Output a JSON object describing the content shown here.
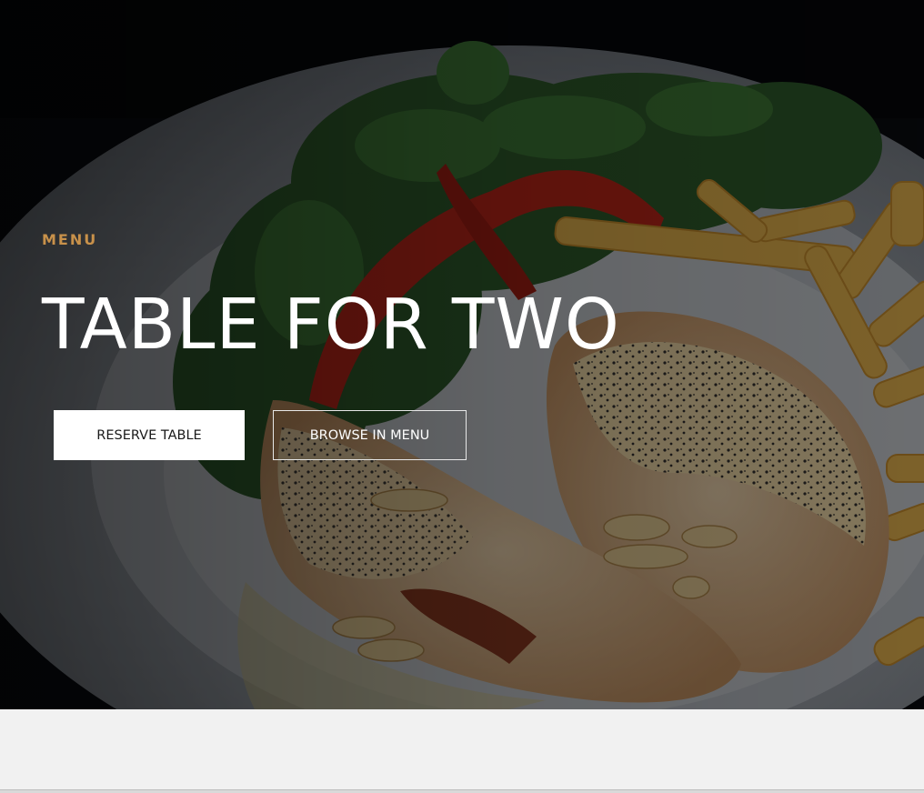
{
  "hero": {
    "eyebrow": "MENU",
    "title": "TABLE FOR TWO",
    "image_alt_icon": "food-photo",
    "buttons": {
      "reserve_label": "RESERVE TABLE",
      "browse_label": "BROWSE IN MENU"
    }
  },
  "colors": {
    "accent": "#c8914a",
    "title": "#ffffff",
    "page_background": "#f1f1f1"
  }
}
